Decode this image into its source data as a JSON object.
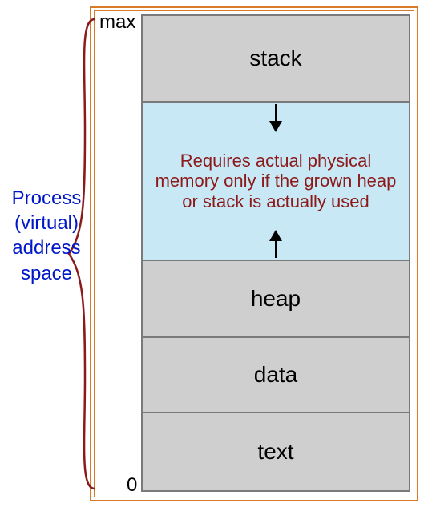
{
  "frame": {
    "max_label": "max",
    "zero_label": "0"
  },
  "regions": {
    "stack": "stack",
    "heap": "heap",
    "data": "data",
    "text": "text"
  },
  "gap_note": "Requires actual physical memory only if the grown heap or stack is actually used",
  "caption_lines": {
    "l1": "Process",
    "l2": "(virtual)",
    "l3": "address",
    "l4": "space"
  },
  "colors": {
    "frame_border": "#d87a2a",
    "region_fill": "#cfcfcf",
    "gap_fill": "#c9e8f5",
    "caption": "#0017c8",
    "gap_text": "#8b1a1a",
    "brace": "#8b1a1a"
  },
  "chart_data": {
    "type": "diagram",
    "title": "Process (virtual) address space",
    "layout_top_to_bottom": [
      "stack",
      "unused (grows)",
      "heap",
      "data",
      "text"
    ],
    "address_axis": {
      "bottom": 0,
      "top": "max"
    },
    "growth": {
      "stack": "down",
      "heap": "up"
    },
    "gap_annotation": "Requires actual physical memory only if the grown heap or stack is actually used"
  }
}
